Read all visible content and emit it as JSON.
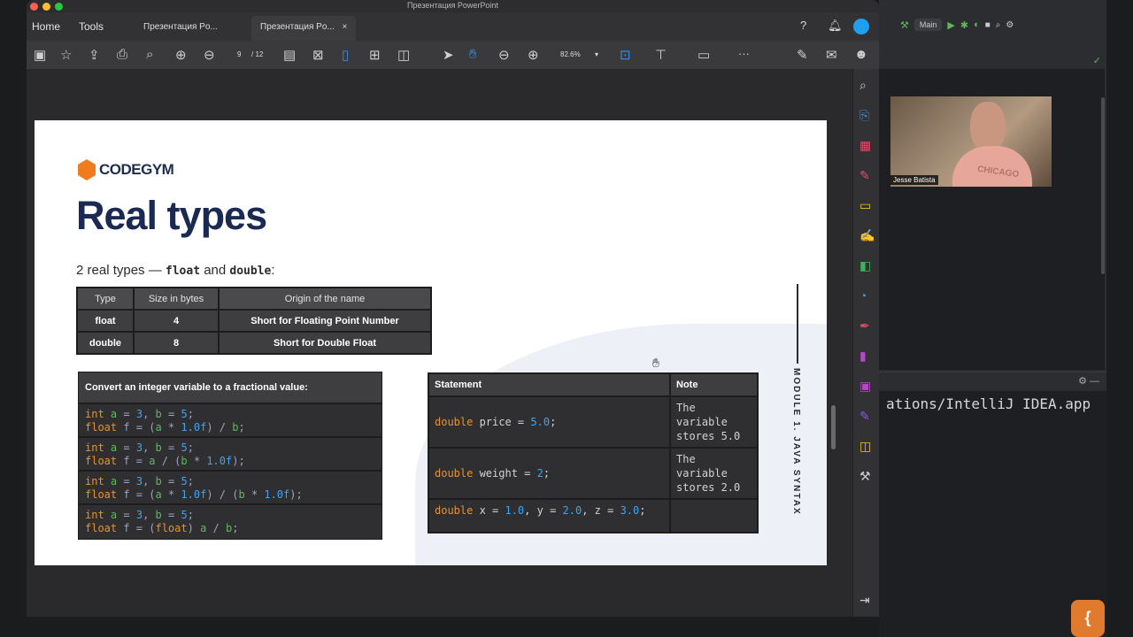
{
  "window": {
    "title": "Презентация PowerPoint"
  },
  "menu": {
    "home": "Home",
    "tools": "Tools"
  },
  "tabs": [
    {
      "label": "Презентация Po..."
    },
    {
      "label": "Презентация Po...",
      "close": "×"
    }
  ],
  "toolbar": {
    "page_current": "9",
    "page_total": "/ 12",
    "zoom": "82.6%",
    "more": "···"
  },
  "slide": {
    "logo": "CODEGYM",
    "title": "Real types",
    "subtitle_prefix": "2 real types — ",
    "subtitle_float": "float",
    "subtitle_and": " and ",
    "subtitle_double": "double",
    "subtitle_colon": ":",
    "types_table": {
      "headers": [
        "Type",
        "Size in bytes",
        "Origin of the name"
      ],
      "rows": [
        [
          "float",
          "4",
          "Short for Floating Point Number"
        ],
        [
          "double",
          "8",
          "Short for Double Float"
        ]
      ]
    },
    "convert_title": "Convert an integer variable to a fractional value:",
    "statement_table": {
      "headers": [
        "Statement",
        "Note"
      ],
      "rows": [
        [
          "double price = 5.0;",
          "The variable stores 5.0"
        ],
        [
          "double weight = 2;",
          "The variable stores 2.0"
        ],
        [
          "double x = 1.0, y = 2.0, z = 3.0;",
          ""
        ]
      ]
    },
    "module_label": "MODULE 1. JAVA SYNTAX"
  },
  "ide": {
    "branch": "Main",
    "terminal_text": "ations/IntelliJ IDEA.app"
  },
  "webcam": {
    "name": "Jesse Batista",
    "shirt_text": "CHICAGO"
  },
  "colors": {
    "accent_orange": "#f07c22",
    "title_navy": "#1b2a52",
    "code_keyword": "#e69230",
    "code_number": "#3fa4f0"
  }
}
